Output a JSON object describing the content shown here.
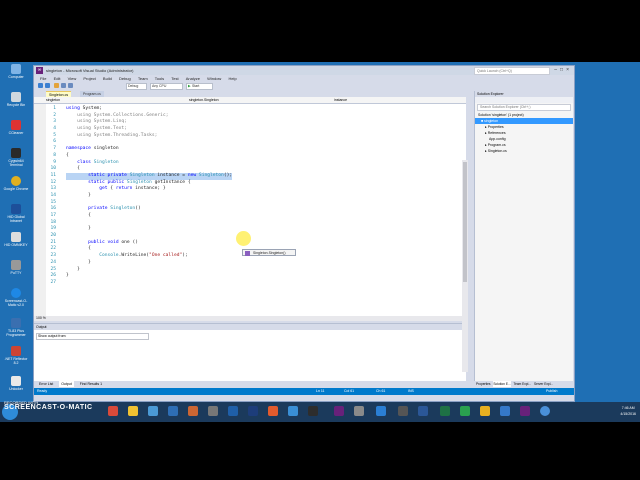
{
  "desktop_icons": [
    "Computer",
    "Recycle Bin",
    "CCleaner",
    "Cygwin64 Terminal",
    "Google Chrome",
    "HID Global Intranet",
    "HID OMNIKEY",
    "PuTTY",
    "Screencast-O-Matic v2.0",
    "TI-83 Plus Programmer",
    ".NET Reflector 8.2",
    "Unlocker"
  ],
  "window": {
    "title": "singleton - Microsoft Visual Studio (Administrator)",
    "quick_launch": "Quick Launch (Ctrl+Q)"
  },
  "menu": [
    "File",
    "Edit",
    "View",
    "Project",
    "Build",
    "Debug",
    "Team",
    "Tools",
    "Test",
    "Analyze",
    "Window",
    "Help"
  ],
  "toolbar": {
    "config": "Debug",
    "platform": "Any CPU",
    "start": "Start"
  },
  "tabs": [
    "Singleton.cs",
    "Program.cs"
  ],
  "nav": {
    "project": "singleton",
    "type": "singleton.Singleton",
    "member": "instance"
  },
  "code": [
    {
      "n": "1",
      "t": "using System;"
    },
    {
      "n": "2",
      "t": "    using System.Collections.Generic;"
    },
    {
      "n": "3",
      "t": "    using System.Linq;"
    },
    {
      "n": "4",
      "t": "    using System.Text;"
    },
    {
      "n": "5",
      "t": "    using System.Threading.Tasks;"
    },
    {
      "n": "6",
      "t": ""
    },
    {
      "n": "7",
      "t": "namespace singleton"
    },
    {
      "n": "8",
      "t": "{"
    },
    {
      "n": "9",
      "t": "    class Singleton"
    },
    {
      "n": "10",
      "t": "    {"
    },
    {
      "n": "11",
      "t": "        static private Singleton instance = new Singleton();"
    },
    {
      "n": "12",
      "t": "        static public Singleton getInstance {"
    },
    {
      "n": "13",
      "t": "            get { return instance; }"
    },
    {
      "n": "14",
      "t": "        }"
    },
    {
      "n": "15",
      "t": ""
    },
    {
      "n": "16",
      "t": "        private Singleton()"
    },
    {
      "n": "17",
      "t": "        {"
    },
    {
      "n": "18",
      "t": ""
    },
    {
      "n": "19",
      "t": "        }"
    },
    {
      "n": "20",
      "t": ""
    },
    {
      "n": "21",
      "t": "        public void one ()"
    },
    {
      "n": "22",
      "t": "        {"
    },
    {
      "n": "23",
      "t": "            Console.WriteLine(\"One called\");"
    },
    {
      "n": "24",
      "t": "        }"
    },
    {
      "n": "25",
      "t": "    }"
    },
    {
      "n": "26",
      "t": "}"
    },
    {
      "n": "27",
      "t": ""
    }
  ],
  "tooltip": "Singleton.Singleton()",
  "zoom": "100 %",
  "output": {
    "title": "Output",
    "show_from": "Show output from:"
  },
  "bottom_tabs": [
    "Error List",
    "Output",
    "Find Results 1"
  ],
  "status": {
    "ready": "Ready",
    "ln": "Ln 11",
    "col": "Col 61",
    "ch": "Ch 61",
    "ins": "INS",
    "publish": "Publish"
  },
  "solution": {
    "title": "Solution Explorer",
    "search": "Search Solution Explorer (Ctrl+;)",
    "nodes": [
      "Solution 'singleton' (1 project)",
      "singleton",
      "Properties",
      "References",
      "App.config",
      "Program.cs",
      "Singleton.cs"
    ]
  },
  "solution_tabs": [
    "Properties",
    "Solution E...",
    "Team Expl...",
    "Server Expl..."
  ],
  "taskbar": {
    "time": "7:46 AM",
    "date": "4/15/2016"
  },
  "watermark": {
    "line1": "RECORDED WITH",
    "line2": "SCREENCAST-O-MATIC"
  }
}
